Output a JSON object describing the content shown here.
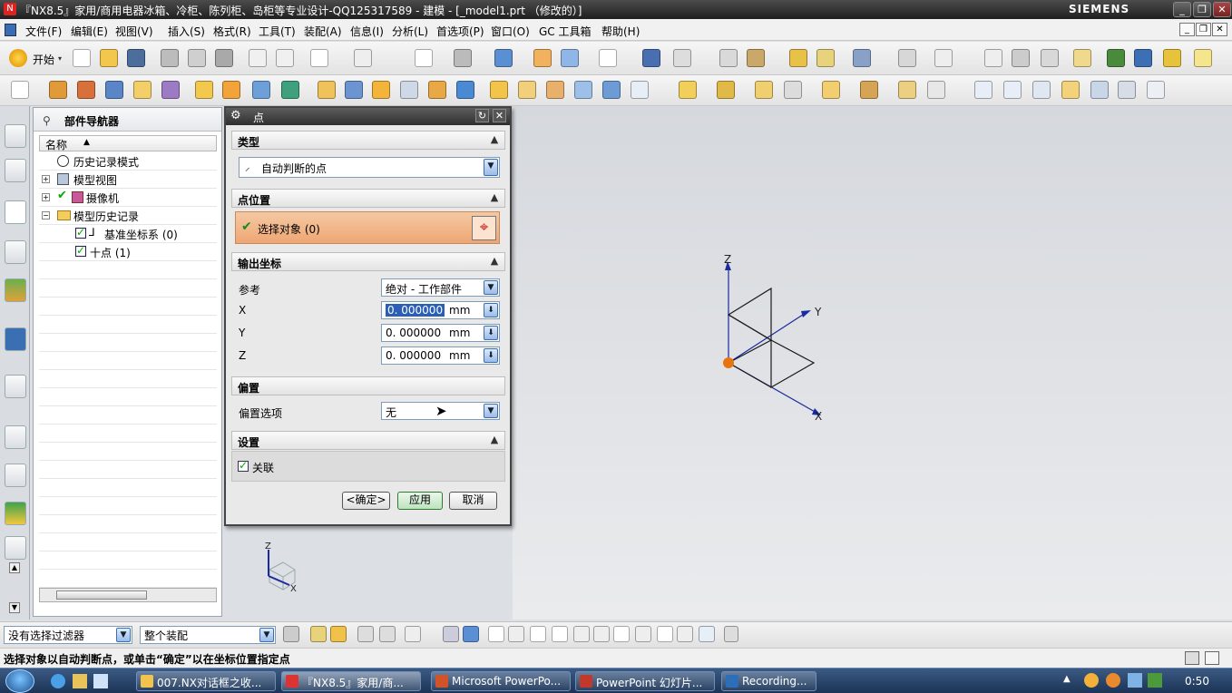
{
  "window": {
    "title": "『NX8.5』家用/商用电器冰箱、冷柜、陈列柜、岛柜等专业设计-QQ125317589 - 建模 - [_model1.prt （修改的）]",
    "brand": "SIEMENS"
  },
  "menu": [
    "文件(F)",
    "编辑(E)",
    "视图(V)",
    "插入(S)",
    "格式(R)",
    "工具(T)",
    "装配(A)",
    "信息(I)",
    "分析(L)",
    "首选项(P)",
    "窗口(O)",
    "GC 工具箱",
    "帮助(H)"
  ],
  "toolbar": {
    "start_label": "开始"
  },
  "navigator": {
    "title": "部件导航器",
    "column": "名称",
    "items": [
      {
        "label": "历史记录模式"
      },
      {
        "label": "模型视图"
      },
      {
        "label": "摄像机"
      },
      {
        "label": "模型历史记录"
      },
      {
        "label": "基准坐标系 (0)"
      },
      {
        "label": "十点 (1)"
      }
    ]
  },
  "dialog": {
    "title": "点",
    "type_section": "类型",
    "type_value": "自动判断的点",
    "point_section": "点位置",
    "select_object": "选择对象 (0)",
    "output_section": "输出坐标",
    "reference_label": "参考",
    "reference_value": "绝对 - 工作部件",
    "x_label": "X",
    "x_value": "0. 000000",
    "x_unit": "mm",
    "y_label": "Y",
    "y_value": "0. 000000",
    "y_unit": "mm",
    "z_label": "Z",
    "z_value": "0. 000000",
    "z_unit": "mm",
    "offset_section": "偏置",
    "offset_label": "偏置选项",
    "offset_value": "无",
    "settings_section": "设置",
    "associative_label": "关联",
    "ok_label": "<确定>",
    "apply_label": "应用",
    "cancel_label": "取消"
  },
  "viewport": {
    "axis_x": "X",
    "axis_y": "Y",
    "axis_z": "Z",
    "triad_x": "X",
    "triad_z": "Z"
  },
  "filters": {
    "selection_filter": "没有选择过滤器",
    "assembly_scope": "整个装配"
  },
  "status": {
    "prompt": "选择对象以自动判断点，或单击“确定”以在坐标位置指定点"
  },
  "taskbar": {
    "tasks": [
      "007.NX对话框之收...",
      "『NX8.5』家用/商...",
      "Microsoft PowerPo...",
      "PowerPoint 幻灯片...",
      "Recording..."
    ],
    "time": "0:50"
  },
  "colors": {
    "accent_orange": "#f0b98a",
    "selection_blue": "#2563c9",
    "taskbar": "#1c3456"
  }
}
